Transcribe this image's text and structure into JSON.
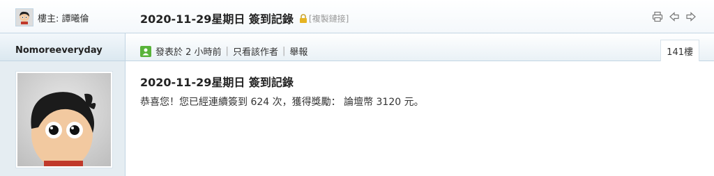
{
  "header": {
    "owner_label": "樓主: 譚曦倫",
    "title": "2020-11-29星期日 簽到記錄",
    "copy_link": "[複製鏈接]"
  },
  "author": {
    "username": "Nomoreeveryday"
  },
  "post_meta": {
    "posted_at": "發表於 2 小時前",
    "only_author": "只看該作者",
    "report": "舉報"
  },
  "floor": "141樓",
  "post": {
    "title": "2020-11-29星期日 簽到記錄",
    "message": "恭喜您！您已經連續簽到 624 次，獲得獎勵： 論壇幣 3120 元。"
  },
  "icons": {
    "print": "printer-icon",
    "prev": "arrow-left-icon",
    "next": "arrow-right-icon",
    "lock": "lock-icon",
    "online": "online-user-icon"
  },
  "colors": {
    "left_bg": "#e5edf2",
    "border": "#c2d5e3",
    "online_green": "#58b33a"
  }
}
